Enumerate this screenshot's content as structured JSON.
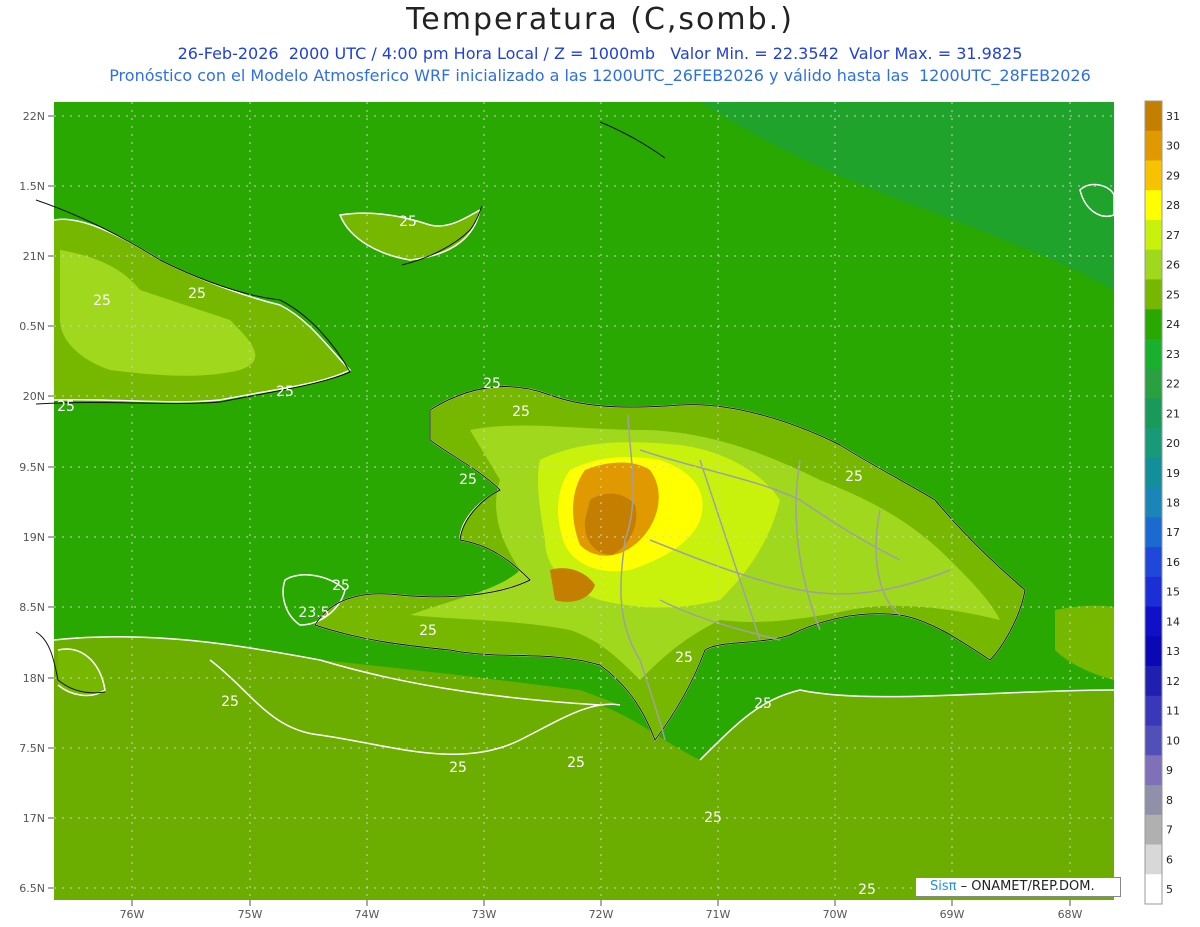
{
  "header": {
    "title": "Temperatura (C,somb.)",
    "line1": "26-Feb-2026  2000 UTC / 4:00 pm Hora Local / Z = 1000mb   Valor Min. = 22.3542  Valor Max. = 31.9825",
    "line2": "Pronóstico con el Modelo Atmosferico WRF inicializado a las 1200UTC_26FEB2026 y válido hasta las  1200UTC_28FEB2026"
  },
  "axes": {
    "lat_labels": [
      "22N",
      "1.5N",
      "21N",
      "0.5N",
      "20N",
      "9.5N",
      "19N",
      "8.5N",
      "18N",
      "7.5N",
      "17N",
      "6.5N"
    ],
    "lon_labels": [
      "76W",
      "75W",
      "74W",
      "73W",
      "72W",
      "71W",
      "70W",
      "69W",
      "68W"
    ]
  },
  "colorbar": {
    "labels": [
      "31",
      "30",
      "29",
      "28",
      "27",
      "26",
      "25",
      "24",
      "23",
      "22",
      "21",
      "20",
      "19",
      "18",
      "17",
      "16",
      "15",
      "14",
      "13",
      "12",
      "11",
      "10",
      "9",
      "8",
      "7",
      "6",
      "5"
    ],
    "colors": [
      "#c47e00",
      "#e09a00",
      "#f7c200",
      "#ffff00",
      "#c8f20c",
      "#a0d81e",
      "#76b800",
      "#28a800",
      "#18b02c",
      "#2aa040",
      "#1a9a5a",
      "#189a78",
      "#12909a",
      "#1a86b8",
      "#1a6ad2",
      "#2048d8",
      "#1c2fd6",
      "#1010c8",
      "#0a08b4",
      "#2020b0",
      "#3838b8",
      "#5050b8",
      "#8070b8",
      "#9090a8",
      "#b0b0b0",
      "#d8d8d8",
      "#ffffff"
    ]
  },
  "contour_labels": [
    "25",
    "25",
    "25",
    "25",
    "25",
    "25",
    "25",
    "23.5",
    "25",
    "25",
    "25",
    "25",
    "25",
    "25",
    "25",
    "25",
    "25",
    "25",
    "25"
  ],
  "credit": {
    "brand": "Sisπ",
    "org": " – ONAMET/REP.DOM."
  }
}
